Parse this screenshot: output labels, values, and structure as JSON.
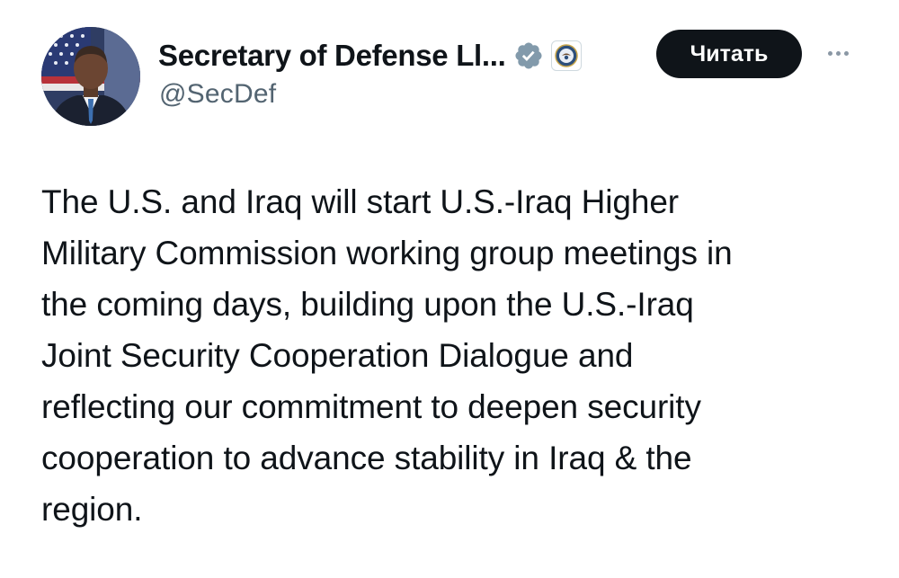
{
  "author": {
    "display_name": "Secretary of Defense Ll...",
    "handle": "@SecDef",
    "verified": true,
    "verified_badge_color": "#829aab",
    "affiliation_icon": "dod-seal-icon",
    "avatar_icon": "profile-photo-avatar"
  },
  "actions": {
    "follow_label": "Читать",
    "more_icon": "more-options-icon"
  },
  "tweet": {
    "lines": [
      "The U.S. and Iraq will start U.S.-Iraq Higher",
      "Military Commission working group meetings in",
      "the coming days, building upon the U.S.-Iraq",
      "Joint Security Cooperation Dialogue and",
      "reflecting our commitment to deepen security",
      "cooperation to advance stability in Iraq & the",
      "region."
    ]
  },
  "colors": {
    "text": "#0f1419",
    "secondary": "#536471",
    "button_bg": "#0f1419",
    "button_text": "#ffffff"
  }
}
